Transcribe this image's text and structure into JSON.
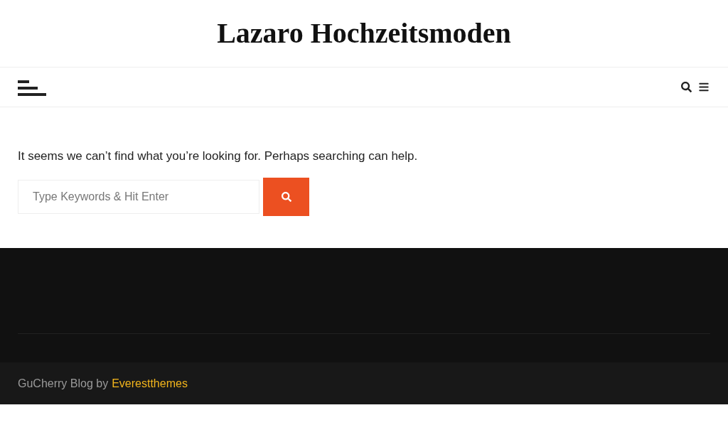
{
  "site_title": "Lazaro Hochzeitsmoden",
  "message": "It seems we can’t find what you’re looking for. Perhaps searching can help.",
  "search": {
    "placeholder": "Type Keywords & Hit Enter"
  },
  "footer": {
    "credit": "GuCherry Blog by",
    "link": "Everestthemes"
  }
}
